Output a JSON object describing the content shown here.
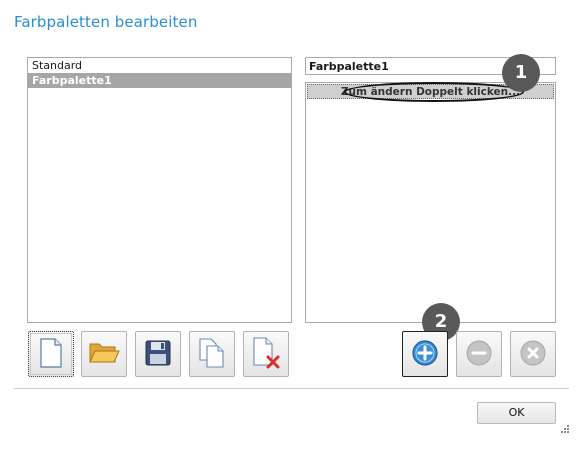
{
  "dialog": {
    "title": "Farbpaletten bearbeiten"
  },
  "palettes": {
    "items": [
      {
        "label": "Standard",
        "selected": false
      },
      {
        "label": "Farbpalette1",
        "selected": true
      }
    ]
  },
  "editor": {
    "name_value": "Farbpalette1",
    "color_rows": [
      "Zum ändern Doppelt klicken..."
    ]
  },
  "callouts": {
    "badge_1": "1",
    "badge_2": "2"
  },
  "toolbar": {
    "icons": [
      "new-document-icon",
      "open-folder-icon",
      "save-disk-icon",
      "copy-document-icon",
      "delete-document-icon"
    ]
  },
  "color_actions": {
    "icons": [
      "add-circle-icon",
      "remove-circle-icon",
      "clear-circle-icon"
    ]
  },
  "footer": {
    "ok_label": "OK"
  },
  "colors": {
    "title": "#2a8fd1",
    "selection": "#a6a6a6",
    "badge": "#595959",
    "add_button": "#3a8fd6",
    "delete_mark": "#d9302c"
  }
}
